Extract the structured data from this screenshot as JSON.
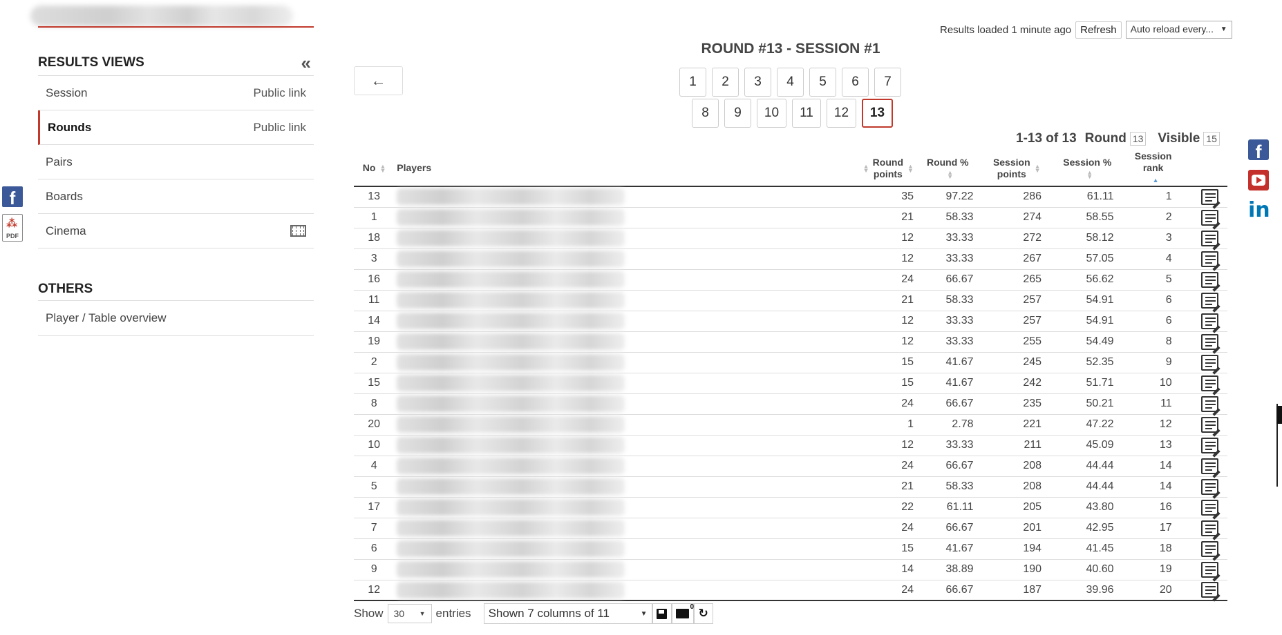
{
  "sidebar": {
    "results_views_title": "RESULTS VIEWS",
    "collapse_icon": "«",
    "items": [
      {
        "label": "Session",
        "link": "Public link"
      },
      {
        "label": "Rounds",
        "link": "Public link",
        "active": true
      },
      {
        "label": "Pairs",
        "link": ""
      },
      {
        "label": "Boards",
        "link": ""
      },
      {
        "label": "Cinema",
        "link": "",
        "icon": "film-icon"
      }
    ],
    "others_title": "OTHERS",
    "others_items": [
      {
        "label": "Player / Table overview"
      }
    ]
  },
  "left_social": {
    "facebook": "f",
    "pdf": "PDF"
  },
  "topbar": {
    "status": "Results loaded 1 minute ago",
    "refresh_label": "Refresh",
    "auto_reload": "Auto reload every...",
    "auto_reload_arrow": "▼"
  },
  "page_title": "ROUND #13 - SESSION #1",
  "back_arrow": "←",
  "pagination": {
    "row1": [
      "1",
      "2",
      "3",
      "4",
      "5",
      "6",
      "7"
    ],
    "row2": [
      "8",
      "9",
      "10",
      "11",
      "12",
      "13"
    ],
    "active": "13"
  },
  "summary": {
    "range": "1-13 of 13",
    "round_label": "Round",
    "round_value": "13",
    "visible_label": "Visible",
    "visible_value": "15"
  },
  "table": {
    "headers": {
      "no": "No",
      "players": "Players",
      "round_points_1": "Round",
      "round_points_2": "points",
      "round_pct": "Round %",
      "session_points_1": "Session",
      "session_points_2": "points",
      "session_pct": "Session %",
      "session_rank_1": "Session",
      "session_rank_2": "rank"
    },
    "rows": [
      {
        "no": "13",
        "rp": "35",
        "r": "97.22",
        "sp": "286",
        "s": "61.11",
        "rank": "1"
      },
      {
        "no": "1",
        "rp": "21",
        "r": "58.33",
        "sp": "274",
        "s": "58.55",
        "rank": "2"
      },
      {
        "no": "18",
        "rp": "12",
        "r": "33.33",
        "sp": "272",
        "s": "58.12",
        "rank": "3"
      },
      {
        "no": "3",
        "rp": "12",
        "r": "33.33",
        "sp": "267",
        "s": "57.05",
        "rank": "4"
      },
      {
        "no": "16",
        "rp": "24",
        "r": "66.67",
        "sp": "265",
        "s": "56.62",
        "rank": "5"
      },
      {
        "no": "11",
        "rp": "21",
        "r": "58.33",
        "sp": "257",
        "s": "54.91",
        "rank": "6"
      },
      {
        "no": "14",
        "rp": "12",
        "r": "33.33",
        "sp": "257",
        "s": "54.91",
        "rank": "6"
      },
      {
        "no": "19",
        "rp": "12",
        "r": "33.33",
        "sp": "255",
        "s": "54.49",
        "rank": "8"
      },
      {
        "no": "2",
        "rp": "15",
        "r": "41.67",
        "sp": "245",
        "s": "52.35",
        "rank": "9"
      },
      {
        "no": "15",
        "rp": "15",
        "r": "41.67",
        "sp": "242",
        "s": "51.71",
        "rank": "10"
      },
      {
        "no": "8",
        "rp": "24",
        "r": "66.67",
        "sp": "235",
        "s": "50.21",
        "rank": "11"
      },
      {
        "no": "20",
        "rp": "1",
        "r": "2.78",
        "sp": "221",
        "s": "47.22",
        "rank": "12"
      },
      {
        "no": "10",
        "rp": "12",
        "r": "33.33",
        "sp": "211",
        "s": "45.09",
        "rank": "13"
      },
      {
        "no": "4",
        "rp": "24",
        "r": "66.67",
        "sp": "208",
        "s": "44.44",
        "rank": "14"
      },
      {
        "no": "5",
        "rp": "21",
        "r": "58.33",
        "sp": "208",
        "s": "44.44",
        "rank": "14"
      },
      {
        "no": "17",
        "rp": "22",
        "r": "61.11",
        "sp": "205",
        "s": "43.80",
        "rank": "16"
      },
      {
        "no": "7",
        "rp": "24",
        "r": "66.67",
        "sp": "201",
        "s": "42.95",
        "rank": "17"
      },
      {
        "no": "6",
        "rp": "15",
        "r": "41.67",
        "sp": "194",
        "s": "41.45",
        "rank": "18"
      },
      {
        "no": "9",
        "rp": "14",
        "r": "38.89",
        "sp": "190",
        "s": "40.60",
        "rank": "19"
      },
      {
        "no": "12",
        "rp": "24",
        "r": "66.67",
        "sp": "187",
        "s": "39.96",
        "rank": "20"
      }
    ]
  },
  "footer": {
    "show_label": "Show",
    "show_value": "30",
    "entries_label": "entries",
    "columns_label": "Shown 7 columns of 11",
    "dropdown_arrow": "▼",
    "load_count": "0",
    "reset_icon": "↻"
  },
  "right_social": {
    "facebook": "f",
    "linkedin": "in"
  },
  "colors": {
    "accent": "#c0392b",
    "facebook": "#3b5998",
    "youtube": "#c4302b",
    "linkedin": "#0077b5"
  }
}
